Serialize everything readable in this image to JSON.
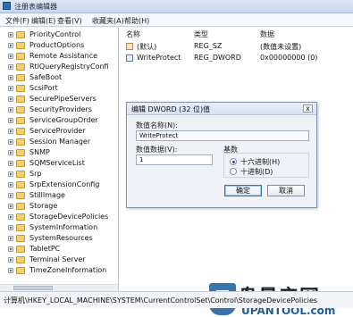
{
  "window": {
    "title": "注册表编辑器",
    "menus": [
      "文件(F)",
      "编辑(E)",
      "查看(V)",
      "收藏夹(A)",
      "帮助(H)"
    ]
  },
  "tree": {
    "items": [
      "PriorityControl",
      "ProductOptions",
      "Remote Assistance",
      "RtlQueryRegistryConfi",
      "SafeBoot",
      "ScsiPort",
      "SecurePipeServers",
      "SecurityProviders",
      "ServiceGroupOrder",
      "ServiceProvider",
      "Session Manager",
      "SNMP",
      "SQMServiceList",
      "Srp",
      "SrpExtensionConfig",
      "StillImage",
      "Storage",
      "StorageDevicePolicies",
      "SystemInformation",
      "SystemResources",
      "TabletPC",
      "Terminal Server",
      "TimeZoneInformation"
    ]
  },
  "values_pane": {
    "headers": {
      "name": "名称",
      "type": "类型",
      "data": "数据"
    },
    "rows": [
      {
        "name": "(默认)",
        "type": "REG_SZ",
        "data": "(数值未设置)"
      },
      {
        "name": "WriteProtect",
        "type": "REG_DWORD",
        "data": "0x00000000 (0)"
      }
    ]
  },
  "dialog": {
    "title": "编辑 DWORD (32 位)值",
    "close": "x",
    "value_name_label": "数值名称(N):",
    "value_name": "WriteProtect",
    "value_data_label": "数值数据(V):",
    "value_data": "1",
    "base_label": "基数",
    "hex_label": "十六进制(H)",
    "dec_label": "十进制(D)",
    "ok": "确定",
    "cancel": "取消"
  },
  "statusbar": {
    "path": "计算机\\HKEY_LOCAL_MACHINE\\SYSTEM\\CurrentControlSet\\Control\\StorageDevicePolicies"
  },
  "watermark": {
    "text": "盘量产网",
    "url": "UPANTOOL.com"
  }
}
